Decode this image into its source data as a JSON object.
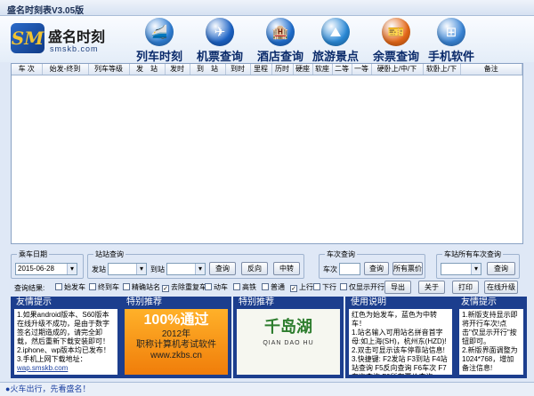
{
  "title": "盛名时刻表V3.05版",
  "logo": {
    "mark": "SM",
    "name": "盛名时刻",
    "url": "smskb.com"
  },
  "nav": [
    {
      "label": "列车时刻",
      "icon": "train-icon",
      "color": "#2f7fd6",
      "glyph": "🚄"
    },
    {
      "label": "机票查询",
      "icon": "plane-icon",
      "color": "#1b63c7",
      "glyph": "✈"
    },
    {
      "label": "酒店查询",
      "icon": "hotel-icon",
      "color": "#1f6fd0",
      "glyph": "🏨"
    },
    {
      "label": "旅游景点",
      "icon": "travel-icon",
      "color": "#2a8ad8",
      "glyph": "⛰"
    },
    {
      "label": "余票查询",
      "icon": "ticket-icon",
      "color": "#e86a19",
      "glyph": "🎫"
    },
    {
      "label": "手机软件",
      "icon": "windows-icon",
      "color": "#3a86d8",
      "glyph": "⊞"
    }
  ],
  "grid": {
    "columns": [
      "车 次",
      "始发-终到",
      "列车等级",
      "发　站",
      "发时",
      "到　站",
      "到时",
      "里程",
      "历时",
      "硬座",
      "软座",
      "二等",
      "一等",
      "硬卧上/中/下",
      "软卧上/下",
      "备注"
    ]
  },
  "date_group": {
    "title": "乘车日期",
    "value": "2015-06-28"
  },
  "station_group": {
    "title": "站站查询",
    "from_label": "发站",
    "to_label": "到站",
    "query": "查询",
    "reverse": "反向",
    "transfer": "中转"
  },
  "train_group": {
    "title": "车次查询",
    "train_label": "车次",
    "query": "查询",
    "all_fares": "所有票价"
  },
  "station_all_group": {
    "title": "车站所有车次查询",
    "query": "查询"
  },
  "results": {
    "label": "查询结果:",
    "checks": [
      {
        "label": "始发车",
        "checked": false
      },
      {
        "label": "终到车",
        "checked": false
      },
      {
        "label": "精确站名",
        "checked": false
      },
      {
        "label": "去除重复车",
        "checked": true
      },
      {
        "label": "动车",
        "checked": false
      },
      {
        "label": "高铁",
        "checked": false
      },
      {
        "label": "普通",
        "checked": false
      },
      {
        "label": "上行",
        "checked": true
      },
      {
        "label": "下行",
        "checked": false
      },
      {
        "label": "仅显示开行",
        "checked": false
      }
    ],
    "buttons": [
      "导出",
      "关于",
      "打印",
      "在线升级"
    ]
  },
  "panels": [
    {
      "title": "友情提示",
      "body": "1.如果android版本、S60版本在线升级不成功，是由于数字签名过期造成的，请完全卸载，然后重新下载安装即可！\n2.iphone、wp版本均已发布！\n3.手机上网下载地址：",
      "link": "wap.smskb.com"
    },
    {
      "title": "特别推荐",
      "ad_big": "100%通过",
      "ad_year": "2012年",
      "ad_text": "职称计算机考试软件",
      "ad_url": "www.zkbs.cn"
    },
    {
      "title": "特别推荐",
      "ad_cn": "千岛湖",
      "ad_en": "QIAN DAO HU"
    },
    {
      "title": "使用说明",
      "body": "红色为始发车，蓝色为中转车！\n1.站名输入可用站名拼音首字母:如上海(SH)，杭州东(HZD)!\n2.双击可显示该车停靠站信息!\n3.快捷键: F2发站 F3到站 F4站站查询 F5反向查询 F6车次 F7车次查询 F9所有票价查询"
    },
    {
      "title": "友情提示",
      "body": "1.新版支持显示即将开行车次!点击\"仅显示开行\"按钮即可。\n2.新版界面调整为1024*768，增加备注信息!"
    }
  ],
  "status": "火车出行，先看盛名！"
}
